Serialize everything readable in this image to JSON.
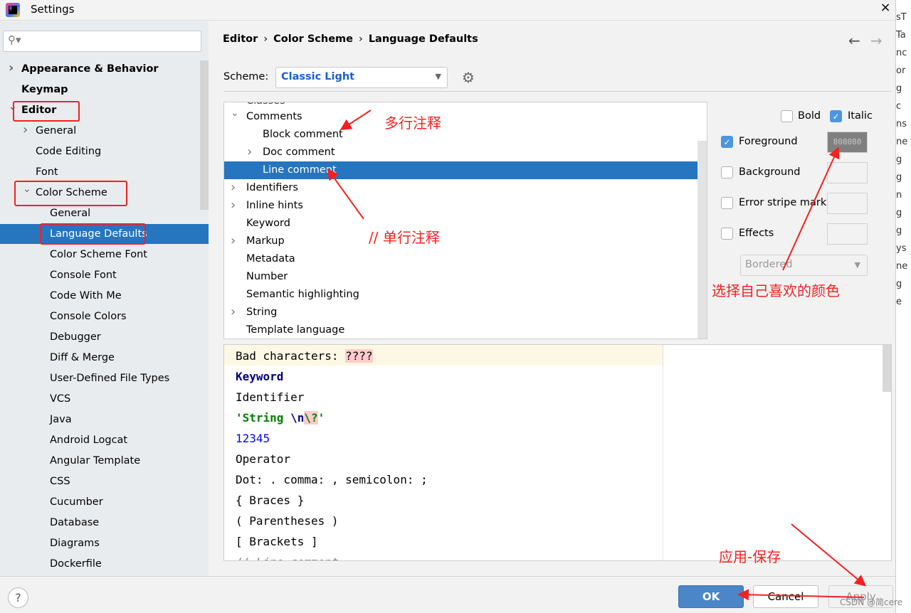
{
  "window": {
    "title": "Settings",
    "close_icon": "×"
  },
  "sidebar": {
    "search_placeholder": "",
    "items": [
      {
        "label": "Appearance & Behavior",
        "bold": true
      },
      {
        "label": "Keymap",
        "bold": true
      },
      {
        "label": "Editor",
        "bold": true
      },
      {
        "label": "General"
      },
      {
        "label": "Code Editing"
      },
      {
        "label": "Font"
      },
      {
        "label": "Color Scheme"
      },
      {
        "label": "General"
      },
      {
        "label": "Language Defaults",
        "selected": true
      },
      {
        "label": "Color Scheme Font"
      },
      {
        "label": "Console Font"
      },
      {
        "label": "Code With Me"
      },
      {
        "label": "Console Colors"
      },
      {
        "label": "Debugger"
      },
      {
        "label": "Diff & Merge"
      },
      {
        "label": "User-Defined File Types"
      },
      {
        "label": "VCS"
      },
      {
        "label": "Java"
      },
      {
        "label": "Android Logcat"
      },
      {
        "label": "Angular Template"
      },
      {
        "label": "CSS"
      },
      {
        "label": "Cucumber"
      },
      {
        "label": "Database"
      },
      {
        "label": "Diagrams"
      },
      {
        "label": "Dockerfile"
      }
    ]
  },
  "breadcrumb": [
    "Editor",
    "Color Scheme",
    "Language Defaults"
  ],
  "breadcrumb_sep": "›",
  "nav": {
    "back": "←",
    "forward": "→"
  },
  "scheme": {
    "label": "Scheme:",
    "value": "Classic Light"
  },
  "tree": {
    "partial_top": "Classes",
    "rows": [
      {
        "label": "Comments",
        "expanded": true
      },
      {
        "label": "Block comment"
      },
      {
        "label": "Doc comment",
        "collapsed": true
      },
      {
        "label": "Line comment",
        "selected": true
      },
      {
        "label": "Identifiers",
        "collapsed": true
      },
      {
        "label": "Inline hints",
        "collapsed": true
      },
      {
        "label": "Keyword"
      },
      {
        "label": "Markup",
        "collapsed": true
      },
      {
        "label": "Metadata"
      },
      {
        "label": "Number"
      },
      {
        "label": "Semantic highlighting"
      },
      {
        "label": "String",
        "collapsed": true
      },
      {
        "label": "Template language"
      }
    ]
  },
  "attributes": {
    "bold": {
      "label": "Bold",
      "checked": false
    },
    "italic": {
      "label": "Italic",
      "checked": true
    },
    "foreground": {
      "label": "Foreground",
      "checked": true,
      "color": "808080",
      "color_hex": "#808080"
    },
    "background": {
      "label": "Background",
      "checked": false
    },
    "error_stripe": {
      "label": "Error stripe mark",
      "checked": false
    },
    "effects": {
      "label": "Effects",
      "checked": false
    },
    "effect_type": "Bordered"
  },
  "preview": {
    "lines": {
      "bad_prefix": "Bad characters: ",
      "bad_chars": "????",
      "keyword": "Keyword",
      "identifier": "Identifier",
      "string_a": "'String ",
      "string_esc": "\\n",
      "string_bad": "\\?",
      "string_end": "'",
      "number": "12345",
      "operator": "Operator",
      "punct": "Dot: . comma: , semicolon: ;",
      "braces": "{ Braces }",
      "parens": "( Parentheses )",
      "brackets": "[ Brackets ]",
      "line_comment": "// Line comment"
    },
    "colors": {
      "keyword": "#000080",
      "string": "#008000",
      "number": "#0000ff",
      "comment": "#808080"
    }
  },
  "buttons": {
    "help": "?",
    "ok": "OK",
    "cancel": "Cancel",
    "apply": "Apply"
  },
  "annotations": {
    "multiline_comment": "多行注释",
    "single_comment": "//  单行注释",
    "choose_color": "选择自己喜欢的颜色",
    "apply_save": "应用-保存",
    "color": "#f52020"
  },
  "watermark": "CSDN @简cere",
  "behind_window_text": "sT\nTa\nnc\nor\ng\nc\nns\nne\ng\ng\nn\ng\ng\nys\nne\ng\ne"
}
